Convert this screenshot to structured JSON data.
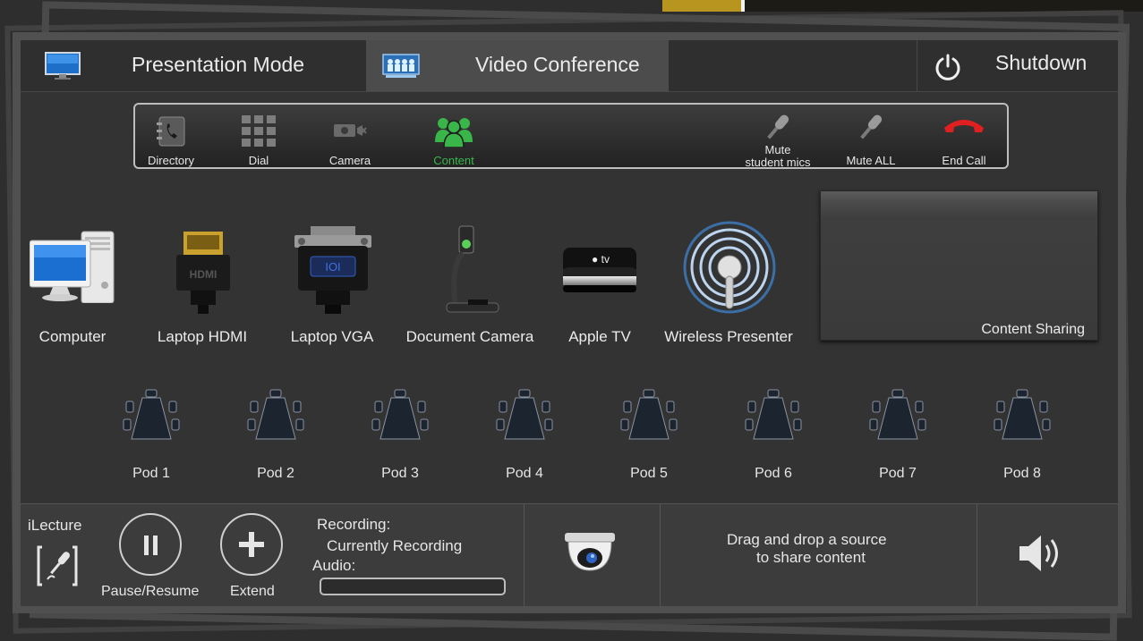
{
  "header": {
    "tabs": [
      {
        "label": "Presentation Mode",
        "icon": "monitor-icon"
      },
      {
        "label": "Video Conference",
        "icon": "conference-icon",
        "active": true
      },
      {
        "label": "Shutdown",
        "icon": "power-icon"
      }
    ]
  },
  "vc_toolbar": {
    "buttons": [
      {
        "label": "Directory",
        "icon": "directory-phone-icon"
      },
      {
        "label": "Dial",
        "icon": "keypad-icon"
      },
      {
        "label": "Camera",
        "icon": "camera-off-icon"
      },
      {
        "label": "Content",
        "icon": "people-group-icon",
        "active": true
      },
      {
        "label_line1": "Mute",
        "label_line2": "student mics",
        "icon": "microphone-icon"
      },
      {
        "label": "Mute ALL",
        "icon": "microphone-icon"
      },
      {
        "label": "End Call",
        "icon": "hang-up-icon"
      }
    ],
    "active_color": "#39b54a",
    "end_call_color": "#e02020"
  },
  "sources": [
    {
      "label": "Computer",
      "icon": "desktop-computer-icon"
    },
    {
      "label": "Laptop HDMI",
      "icon": "hdmi-connector-icon"
    },
    {
      "label": "Laptop VGA",
      "icon": "vga-connector-icon"
    },
    {
      "label": "Document Camera",
      "icon": "document-camera-icon"
    },
    {
      "label": "Apple TV",
      "icon": "apple-tv-icon"
    },
    {
      "label": "Wireless Presenter",
      "icon": "wireless-presenter-icon"
    }
  ],
  "content_sharing": {
    "label": "Content Sharing"
  },
  "pods": [
    "Pod 1",
    "Pod 2",
    "Pod 3",
    "Pod 4",
    "Pod 5",
    "Pod 6",
    "Pod 7",
    "Pod 8"
  ],
  "footer": {
    "ilecture_label": "iLecture",
    "pause_label": "Pause/Resume",
    "extend_label": "Extend",
    "recording_label": "Recording:",
    "recording_status": "Currently Recording",
    "audio_label": "Audio:",
    "drag_line1": "Drag and drop a source",
    "drag_line2": "to share content"
  }
}
